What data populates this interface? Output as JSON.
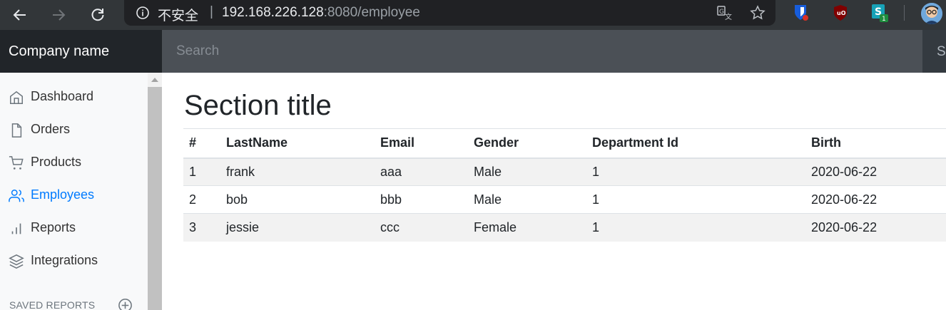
{
  "browser": {
    "security_label": "不安全",
    "separator": "|",
    "url_host": "192.168.226.128",
    "url_path": ":8080/employee",
    "extensions": [
      "bitwarden-icon",
      "ublock-icon",
      "s-extension-icon"
    ],
    "extension_badge": "1"
  },
  "navbar": {
    "brand": "Company name",
    "search_placeholder": "Search",
    "signout": "Sign out"
  },
  "sidebar": {
    "items": [
      {
        "label": "Dashboard",
        "icon": "home-icon"
      },
      {
        "label": "Orders",
        "icon": "file-icon"
      },
      {
        "label": "Products",
        "icon": "shopping-cart-icon"
      },
      {
        "label": "Employees",
        "icon": "users-icon",
        "active": true
      },
      {
        "label": "Reports",
        "icon": "bar-chart-icon"
      },
      {
        "label": "Integrations",
        "icon": "layers-icon"
      }
    ],
    "saved_reports": "SAVED REPORTS"
  },
  "main": {
    "title": "Section title",
    "columns": [
      "#",
      "LastName",
      "Email",
      "Gender",
      "Department Id",
      "Birth"
    ],
    "rows": [
      [
        "1",
        "frank",
        "aaa",
        "Male",
        "1",
        "2020-06-22"
      ],
      [
        "2",
        "bob",
        "bbb",
        "Male",
        "1",
        "2020-06-22"
      ],
      [
        "3",
        "jessie",
        "ccc",
        "Female",
        "1",
        "2020-06-22"
      ]
    ]
  },
  "colors": {
    "accent": "#007bff",
    "navbar": "#343a40",
    "brand_bg": "#212529",
    "chrome": "#323639"
  }
}
